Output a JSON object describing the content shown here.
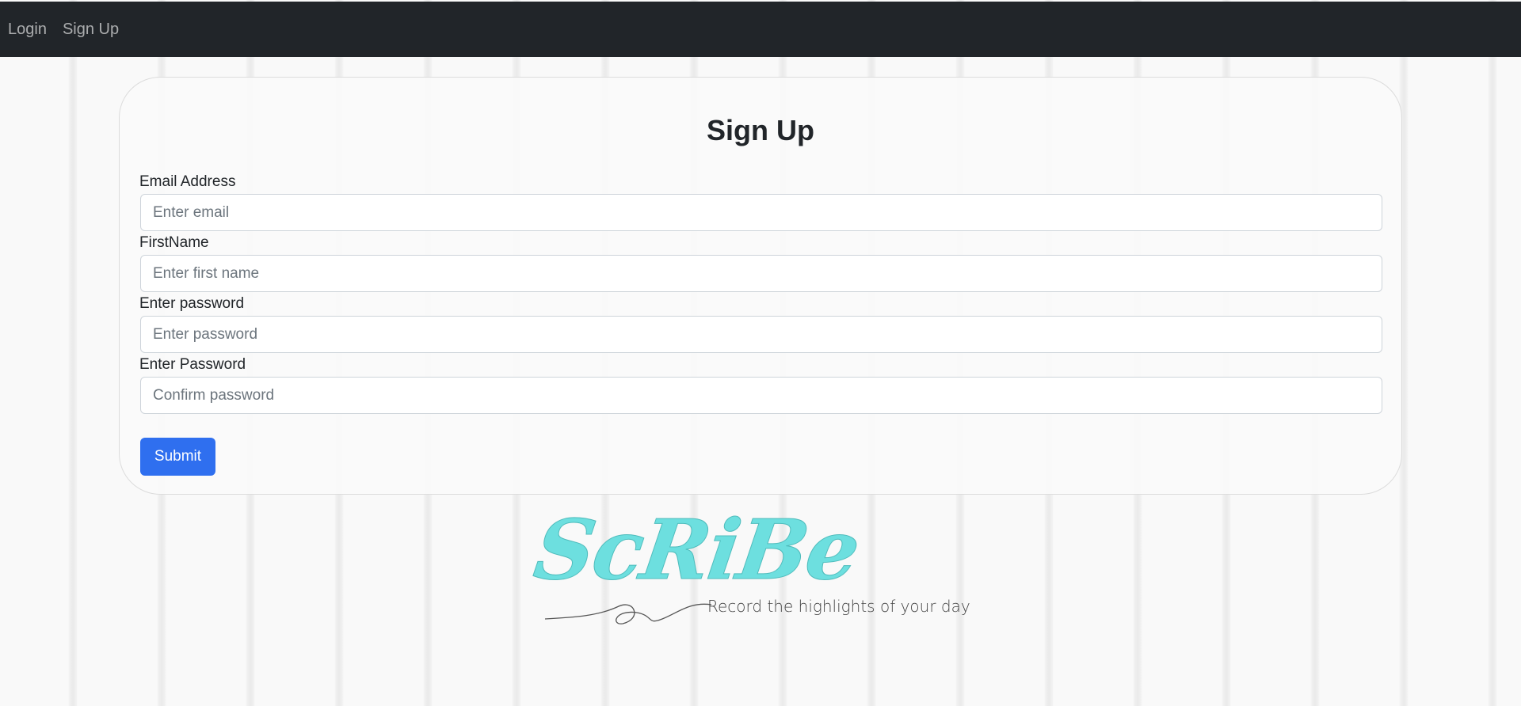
{
  "nav": {
    "items": [
      {
        "label": "Login"
      },
      {
        "label": "Sign Up"
      }
    ]
  },
  "form": {
    "title": "Sign Up",
    "fields": [
      {
        "label": "Email Address",
        "placeholder": "Enter email",
        "value": ""
      },
      {
        "label": "FirstName",
        "placeholder": "Enter first name",
        "value": ""
      },
      {
        "label": "Enter password",
        "placeholder": "Enter password",
        "value": ""
      },
      {
        "label": "Enter Password",
        "placeholder": "Confirm password",
        "value": ""
      }
    ],
    "submit_label": "Submit"
  },
  "logo": {
    "text": "ScRiBe",
    "tagline": "Record the highlights of your day",
    "color": "#6ddfdf"
  },
  "colors": {
    "navbar": "#212529",
    "primary_button": "#2f6fef",
    "background": "#f9f9f9"
  }
}
